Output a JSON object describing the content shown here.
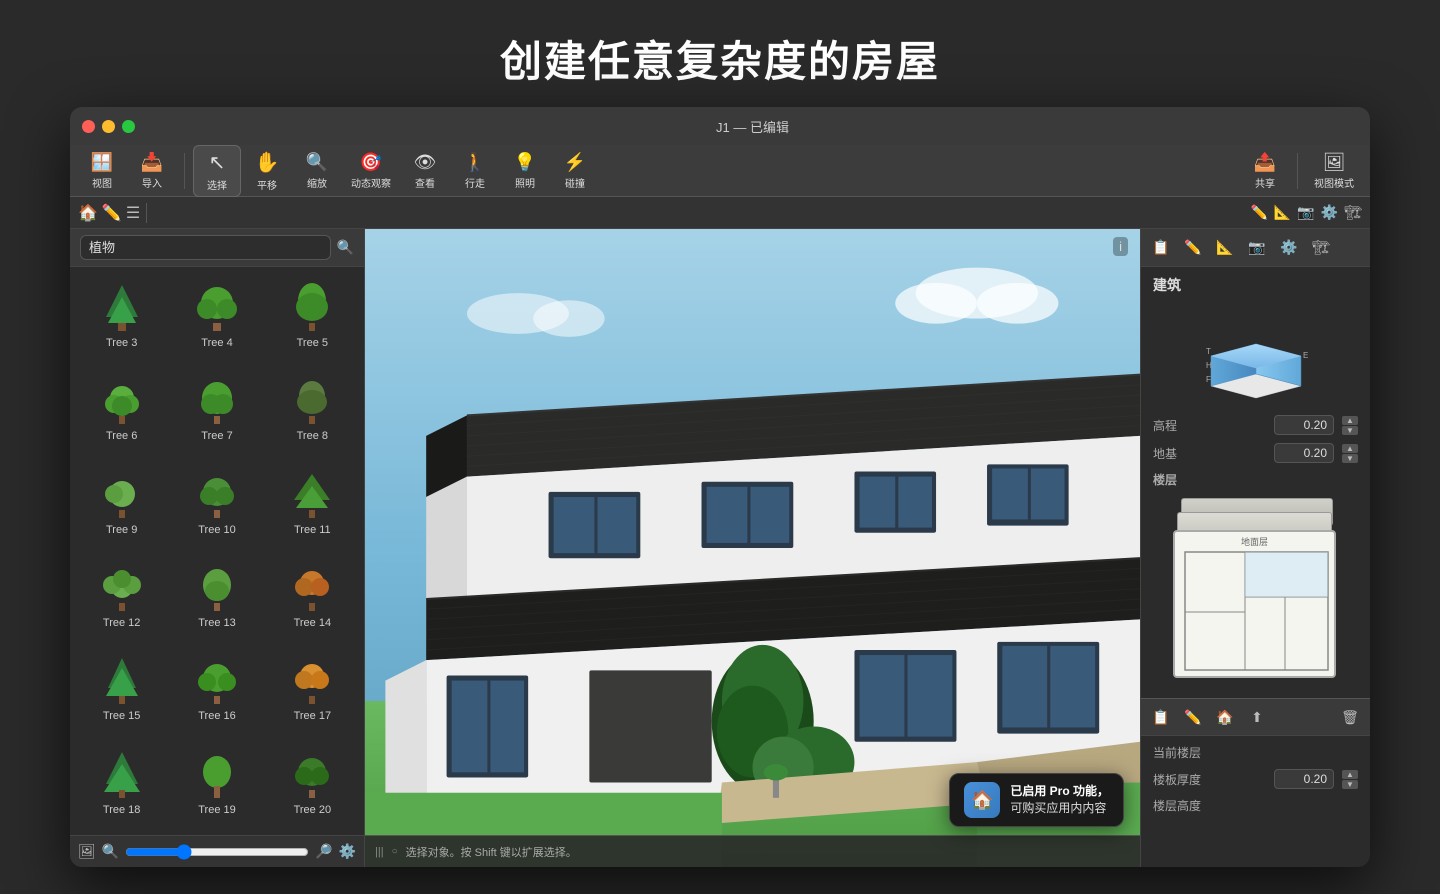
{
  "page": {
    "title": "创建任意复杂度的房屋",
    "window_title": "J1 — 已编辑"
  },
  "toolbar": {
    "left_group": [
      {
        "label": "视图",
        "icon": "🪟"
      },
      {
        "label": "导入",
        "icon": "📥"
      }
    ],
    "tools": [
      {
        "label": "选择",
        "icon": "↖",
        "active": true
      },
      {
        "label": "平移",
        "icon": "✋"
      },
      {
        "label": "缩放",
        "icon": "🔍"
      },
      {
        "label": "动态观察",
        "icon": "🎯"
      },
      {
        "label": "查看",
        "icon": "👁"
      },
      {
        "label": "行走",
        "icon": "🚶"
      },
      {
        "label": "照明",
        "icon": "💡"
      },
      {
        "label": "碰撞",
        "icon": "⚡"
      }
    ],
    "right_group": [
      {
        "label": "共享",
        "icon": "📤"
      },
      {
        "label": "视图模式",
        "icon": "🖼"
      }
    ]
  },
  "left_sidebar": {
    "category": "植物",
    "search_placeholder": "搜索",
    "trees": [
      {
        "id": 3,
        "label": "Tree 3",
        "emoji": "🌲"
      },
      {
        "id": 4,
        "label": "Tree 4",
        "emoji": "🌳"
      },
      {
        "id": 5,
        "label": "Tree 5",
        "emoji": "🌴"
      },
      {
        "id": 6,
        "label": "Tree 6",
        "emoji": "🌿"
      },
      {
        "id": 7,
        "label": "Tree 7",
        "emoji": "🌳"
      },
      {
        "id": 8,
        "label": "Tree 8",
        "emoji": "🌲"
      },
      {
        "id": 9,
        "label": "Tree 9",
        "emoji": "🌱"
      },
      {
        "id": 10,
        "label": "Tree 10",
        "emoji": "🌳"
      },
      {
        "id": 11,
        "label": "Tree 11",
        "emoji": "🌲"
      },
      {
        "id": 12,
        "label": "Tree 12",
        "emoji": "🌿"
      },
      {
        "id": 13,
        "label": "Tree 13",
        "emoji": "🌳"
      },
      {
        "id": 14,
        "label": "Tree 14",
        "emoji": "🍂"
      },
      {
        "id": 15,
        "label": "Tree 15",
        "emoji": "🌲"
      },
      {
        "id": 16,
        "label": "Tree 16",
        "emoji": "🌳"
      },
      {
        "id": 17,
        "label": "Tree 17",
        "emoji": "🍁"
      },
      {
        "id": 18,
        "label": "Tree 18",
        "emoji": "🌲"
      },
      {
        "id": 19,
        "label": "Tree 19",
        "emoji": "🌳"
      },
      {
        "id": 20,
        "label": "Tree 20",
        "emoji": "🌲"
      }
    ]
  },
  "viewport": {
    "status_text": "选择对象。按 Shift 键以扩展选择。",
    "info_label": "i"
  },
  "right_panel": {
    "section_building": "建筑",
    "prop_elevation_label": "高程",
    "prop_elevation_value": "0.20",
    "prop_base_label": "地基",
    "prop_base_value": "0.20",
    "section_floor": "楼层",
    "section_current_floor": "当前楼层",
    "prop_slab_label": "楼板厚度",
    "prop_slab_value": "0.20",
    "prop_floor_height_label": "楼层高度",
    "floor_plan_label": "地面层"
  },
  "pro_badge": {
    "text1": "已启用 Pro 功能，",
    "text2": "可购买应用内内容"
  }
}
